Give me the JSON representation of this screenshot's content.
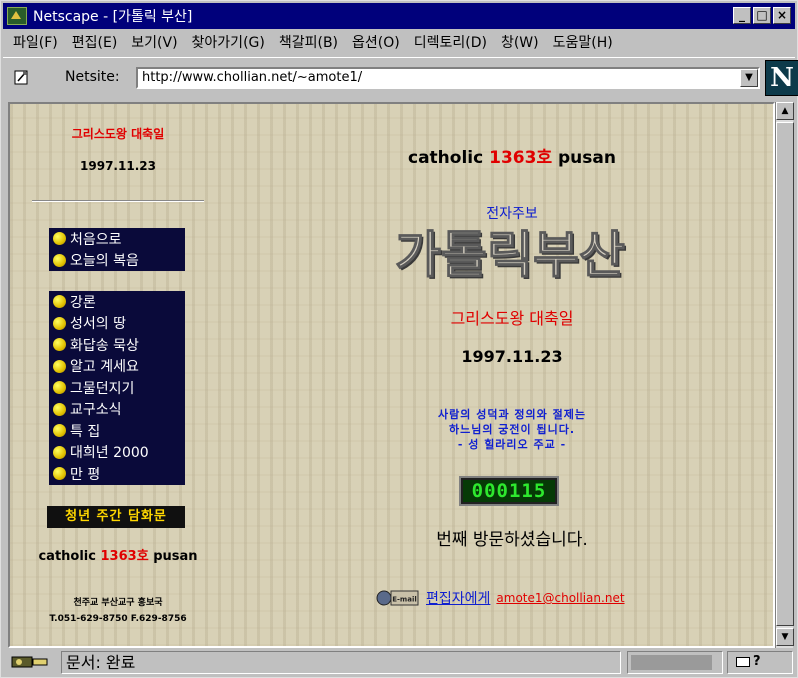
{
  "window": {
    "title": "Netscape - [가톨릭 부산]",
    "controls": [
      "_",
      "□",
      "×"
    ]
  },
  "menu": [
    "파일(F)",
    "편집(E)",
    "보기(V)",
    "찾아가기(G)",
    "책갈피(B)",
    "옵션(O)",
    "디렉토리(D)",
    "창(W)",
    "도움말(H)"
  ],
  "location": {
    "label": "Netsite:",
    "url": "http://www.chollian.net/~amote1/"
  },
  "brand_logo": "N",
  "left": {
    "feast": "그리스도왕 대축일",
    "date": "1997.11.23",
    "nav_group1": [
      "처음으로",
      "오늘의 복음"
    ],
    "nav_group2": [
      "강론",
      "성서의 땅",
      "화답송 묵상",
      "알고 계세요",
      "그물던지기",
      "교구소식",
      "특 집",
      "대희년 2000",
      "만 평"
    ],
    "banner": "청년 주간 담화문",
    "catholic_a": "catholic",
    "catholic_num": "1363",
    "catholic_ho": "호",
    "catholic_b": "pusan",
    "org": "천주교 부산교구 홍보국",
    "tel": "T.051-629-8750 F.629-8756"
  },
  "center": {
    "head_a": "catholic",
    "head_num": "1363",
    "head_ho": "호",
    "head_b": "pusan",
    "weekly": "전자주보",
    "logo_text": "가톨릭부산",
    "feast": "그리스도왕 대축일",
    "date": "1997.11.23",
    "quote_1": "사람의 성덕과 정의와 절제는",
    "quote_2": "하느님의 궁전이 됩니다.",
    "quote_3": "- 성 힐라리오 주교 -",
    "counter": "000115",
    "visit_text": "번째 방문하셨습니다.",
    "mail_icon_text": "E-mail",
    "to_editor": "편집자에게",
    "email": "amote1@chollian.net"
  },
  "status": {
    "text": "문서: 완료",
    "progress": 0.93
  },
  "colors": {
    "title_bar": "#00007b",
    "accent_red": "#e00000",
    "link_blue": "#1020d0",
    "nav_bg": "#0a0a3a",
    "counter_green": "#2ee82e"
  }
}
